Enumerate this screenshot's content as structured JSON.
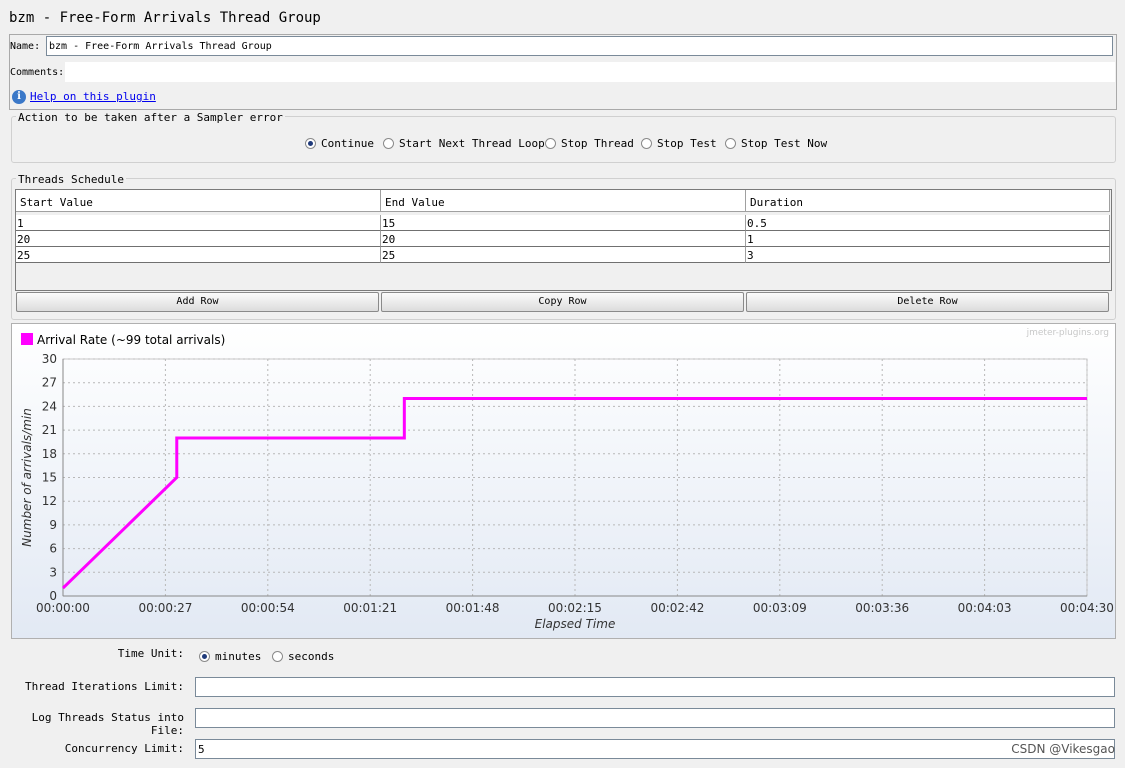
{
  "title": "bzm - Free-Form Arrivals Thread Group",
  "name": {
    "label": "Name:",
    "value": "bzm - Free-Form Arrivals Thread Group"
  },
  "comments": {
    "label": "Comments:",
    "value": ""
  },
  "help": {
    "icon": "info-icon",
    "glyph": "i",
    "link_text": "Help on this plugin"
  },
  "sampler_error": {
    "legend": "Action to be taken after a Sampler error",
    "options": [
      "Continue",
      "Start Next Thread Loop",
      "Stop Thread",
      "Stop Test",
      "Stop Test Now"
    ],
    "selected": "Continue"
  },
  "schedule": {
    "legend": "Threads Schedule",
    "columns": [
      "Start Value",
      "End Value",
      "Duration"
    ],
    "rows": [
      [
        "1",
        "15",
        "0.5"
      ],
      [
        "20",
        "20",
        "1"
      ],
      [
        "25",
        "25",
        "3"
      ]
    ],
    "buttons": {
      "add": "Add Row",
      "copy": "Copy Row",
      "delete": "Delete Row"
    }
  },
  "chart_data": {
    "type": "line",
    "series": [
      {
        "name": "Arrival Rate (~99 total arrivals)",
        "color": "#ff00ff",
        "x": [
          "00:00:00",
          "00:00:30",
          "00:00:30",
          "00:01:30",
          "00:01:30",
          "00:04:30"
        ],
        "y": [
          1,
          15,
          20,
          20,
          25,
          25
        ]
      }
    ],
    "xlabel": "Elapsed Time",
    "ylabel": "Number of arrivals/min",
    "x_ticks": [
      "00:00:00",
      "00:00:27",
      "00:00:54",
      "00:01:21",
      "00:01:48",
      "00:02:15",
      "00:02:42",
      "00:03:09",
      "00:03:36",
      "00:04:03",
      "00:04:30"
    ],
    "y_ticks": [
      0,
      3,
      6,
      9,
      12,
      15,
      18,
      21,
      24,
      27,
      30
    ],
    "xlim": [
      "00:00:00",
      "00:04:30"
    ],
    "ylim": [
      0,
      30
    ],
    "grid": true,
    "legend_position": "top-left",
    "watermark": "jmeter-plugins.org"
  },
  "time_unit": {
    "label": "Time Unit:",
    "options": [
      "minutes",
      "seconds"
    ],
    "selected": "minutes"
  },
  "iterations": {
    "label": "Thread Iterations Limit:",
    "value": ""
  },
  "log_status": {
    "label": "Log Threads Status into File:",
    "value": ""
  },
  "concurrency": {
    "label": "Concurrency Limit:",
    "value": "5"
  },
  "footer_watermark": "CSDN @Vikesgao"
}
